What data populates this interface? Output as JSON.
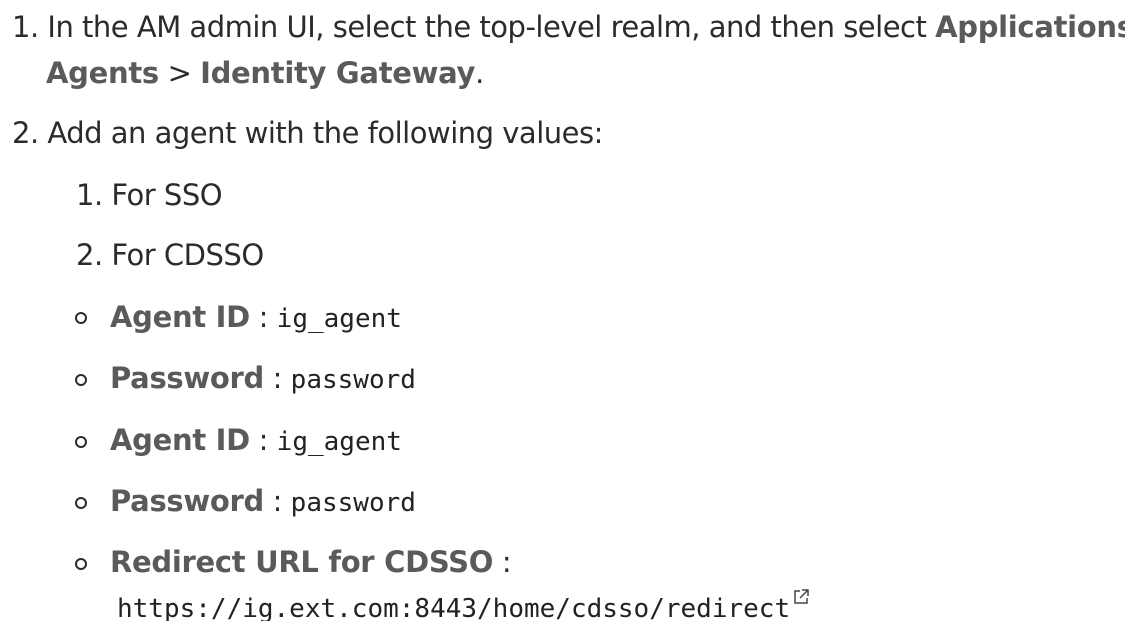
{
  "steps": [
    {
      "number": "1.",
      "text_before": "In the AM admin UI, select the top-level realm, and then select",
      "nav_applications": "Applications",
      "nav_sep1": ">",
      "nav_agents": "Agents",
      "nav_sep2": ">",
      "nav_identity_gateway": "Identity Gateway",
      "text_after": "."
    },
    {
      "number": "2.",
      "text": "Add an agent with the following values:",
      "substeps": [
        {
          "number": "1.",
          "text": "For SSO"
        },
        {
          "number": "2.",
          "text": "For CDSSO"
        }
      ],
      "values": [
        {
          "label": "Agent ID",
          "sep": ":",
          "value": "ig_agent"
        },
        {
          "label": "Password",
          "sep": ":",
          "value": "password"
        },
        {
          "label": "Agent ID",
          "sep": ":",
          "value": "ig_agent"
        },
        {
          "label": "Password",
          "sep": ":",
          "value": "password"
        },
        {
          "label": "Redirect URL for CDSSO",
          "sep": ":",
          "value": "https://ig.ext.com:8443/home/cdsso/redirect",
          "icon": "external-link-icon"
        }
      ]
    }
  ]
}
